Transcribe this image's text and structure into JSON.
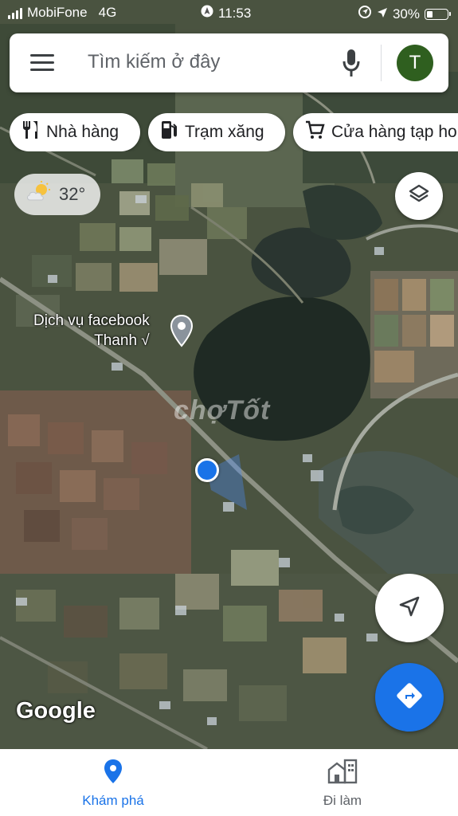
{
  "status_bar": {
    "carrier": "MobiFone",
    "network": "4G",
    "time": "11:53",
    "battery": "30%",
    "battery_level": 0.3
  },
  "search": {
    "placeholder": "Tìm kiếm ở đây",
    "avatar_initial": "T"
  },
  "chips": [
    {
      "label": "Nhà hàng",
      "icon": "fork-knife-icon"
    },
    {
      "label": "Trạm xăng",
      "icon": "gas-station-icon"
    },
    {
      "label": "Cửa hàng tạp ho",
      "icon": "shopping-cart-icon"
    }
  ],
  "weather": {
    "temp": "32°",
    "icon": "partly-sunny-icon"
  },
  "map": {
    "place_name_line1": "Dịch vụ facebook",
    "place_name_line2": "Thanh √",
    "watermark": "chợTốt",
    "attribution": "Google",
    "colors": {
      "accent": "#1a73e8",
      "place_pin": "#8a939c"
    }
  },
  "bottom_nav": {
    "explore_label": "Khám phá",
    "commute_label": "Đi làm",
    "active_color": "#1a73e8",
    "inactive_color": "#5f6368"
  }
}
